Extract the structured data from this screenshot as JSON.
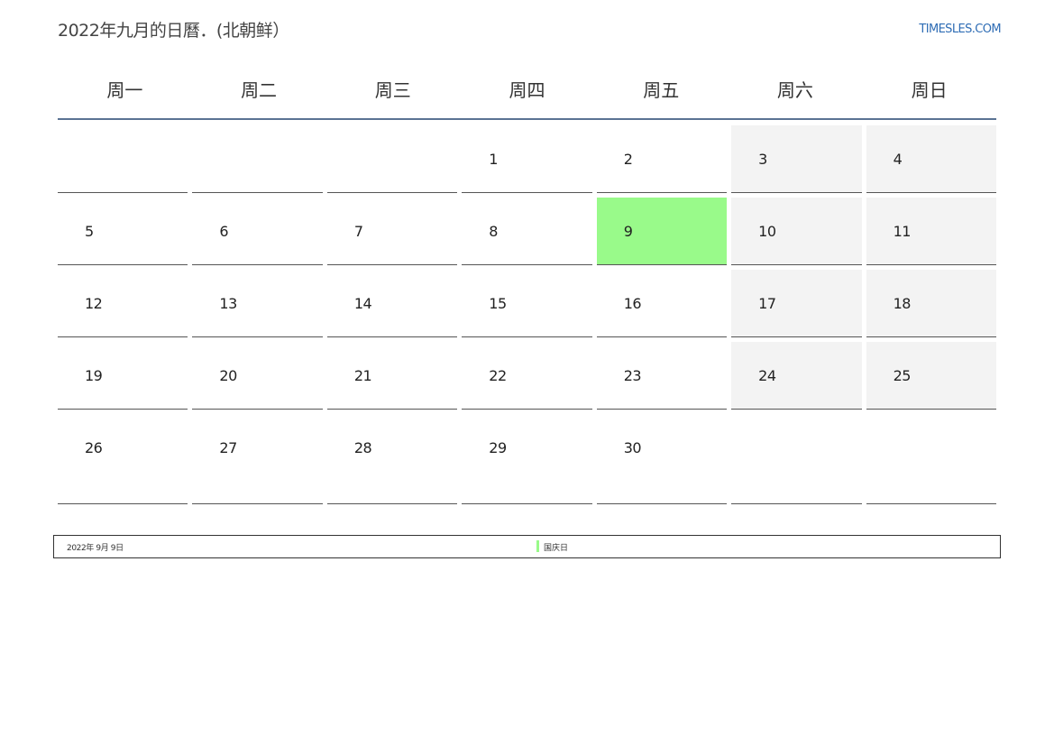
{
  "header": {
    "title": "2022年九月的日曆．(北朝鲜）",
    "site": "TIMESLES.COM"
  },
  "weekdays": [
    "周一",
    "周二",
    "周三",
    "周四",
    "周五",
    "周六",
    "周日"
  ],
  "days": {
    "d1": "1",
    "d2": "2",
    "d3": "3",
    "d4": "4",
    "d5": "5",
    "d6": "6",
    "d7": "7",
    "d8": "8",
    "d9": "9",
    "d10": "10",
    "d11": "11",
    "d12": "12",
    "d13": "13",
    "d14": "14",
    "d15": "15",
    "d16": "16",
    "d17": "17",
    "d18": "18",
    "d19": "19",
    "d20": "20",
    "d21": "21",
    "d22": "22",
    "d23": "23",
    "d24": "24",
    "d25": "25",
    "d26": "26",
    "d27": "27",
    "d28": "28",
    "d29": "29",
    "d30": "30"
  },
  "holidays": [
    {
      "date": "2022年 9月 9日",
      "name": "国庆日"
    }
  ],
  "colors": {
    "holiday": "#99fa8a",
    "weekend": "#f3f3f3",
    "header_rule": "#5a7393",
    "site_link": "#2f6db5"
  }
}
